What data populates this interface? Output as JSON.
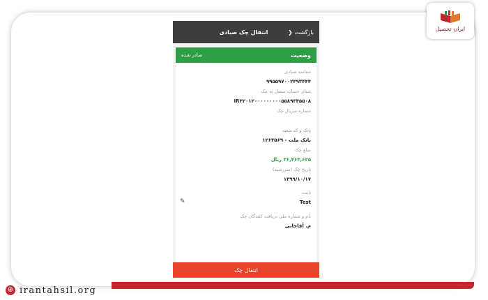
{
  "brand": {
    "logo_text": "ایران تحصیل",
    "site_url": "irantahsil.org"
  },
  "colors": {
    "topbar": "#3d3d3d",
    "status_green": "#2e9e46",
    "action_red": "#e8432b",
    "brand_red": "#c0282e"
  },
  "topbar": {
    "title": "انتقال چک صیادی",
    "back_label": "بازگشت",
    "back_icon": "chevron-left-icon"
  },
  "status": {
    "label": "وضعیت",
    "value": "صادر شده"
  },
  "fields": [
    {
      "label": "شناسه صیادی",
      "value": "۹۹۵۵۹۷۰۰۲۴۹۳۴۴۴"
    },
    {
      "label": "شبای حساب متصل به چک",
      "value": "IR۳۲۰۱۲۰۰۰۰۰۰۰۰۰۵۵۸۹۳۴۵۵۰۸"
    },
    {
      "label": "شماره سریال چک",
      "value": ""
    },
    {
      "label": "بانک و کد شعبه",
      "value": "بانک ملت - ۱۲۶۳۵۶۹"
    },
    {
      "label": "مبلغ چک",
      "value": "۳۶,۴۶۳,۶۲۵ ریال"
    },
    {
      "label": "تاریخ چک (سررسید)",
      "value": "۱۳۹۹/۱۰/۱۷"
    },
    {
      "label": "بابت",
      "value": "Test"
    },
    {
      "label": "نام و شماره ملی دریافت کنندگان چک",
      "value": "م. آقاجانی"
    }
  ],
  "action": {
    "label": "انتقال چک"
  }
}
